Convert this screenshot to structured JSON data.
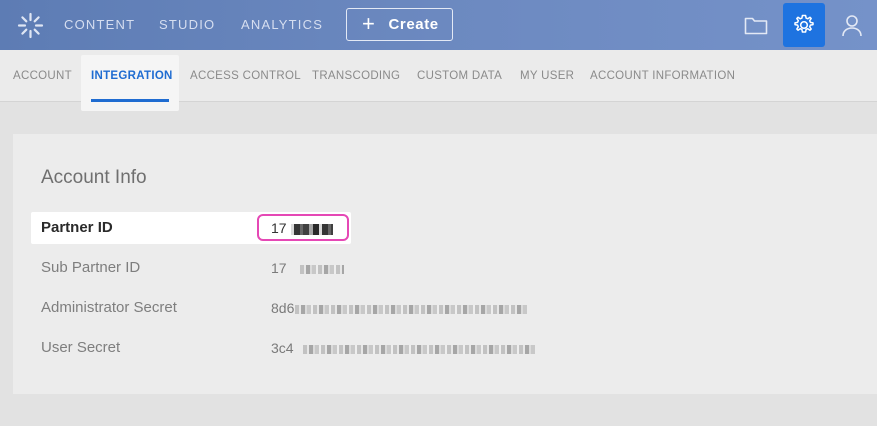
{
  "topbar": {
    "nav": [
      "CONTENT",
      "STUDIO",
      "ANALYTICS"
    ],
    "create_label": "Create",
    "icons": [
      "folder-icon",
      "gear-icon",
      "user-icon"
    ],
    "accent_color": "#1e73e0"
  },
  "subnav": {
    "tabs": [
      {
        "label": "ACCOUNT",
        "active": false
      },
      {
        "label": "INTEGRATION",
        "active": true
      },
      {
        "label": "ACCESS CONTROL",
        "active": false
      },
      {
        "label": "TRANSCODING",
        "active": false
      },
      {
        "label": "CUSTOM DATA",
        "active": false
      },
      {
        "label": "MY USER",
        "active": false
      },
      {
        "label": "ACCOUNT INFORMATION",
        "active": false
      }
    ]
  },
  "account_info": {
    "title": "Account Info",
    "rows": [
      {
        "label": "Partner ID",
        "value": "17"
      },
      {
        "label": "Sub Partner ID",
        "value": "17"
      },
      {
        "label": "Administrator Secret",
        "value": "8d6"
      },
      {
        "label": "User Secret",
        "value": "3c4"
      }
    ],
    "highlight_color": "#e548b5"
  }
}
